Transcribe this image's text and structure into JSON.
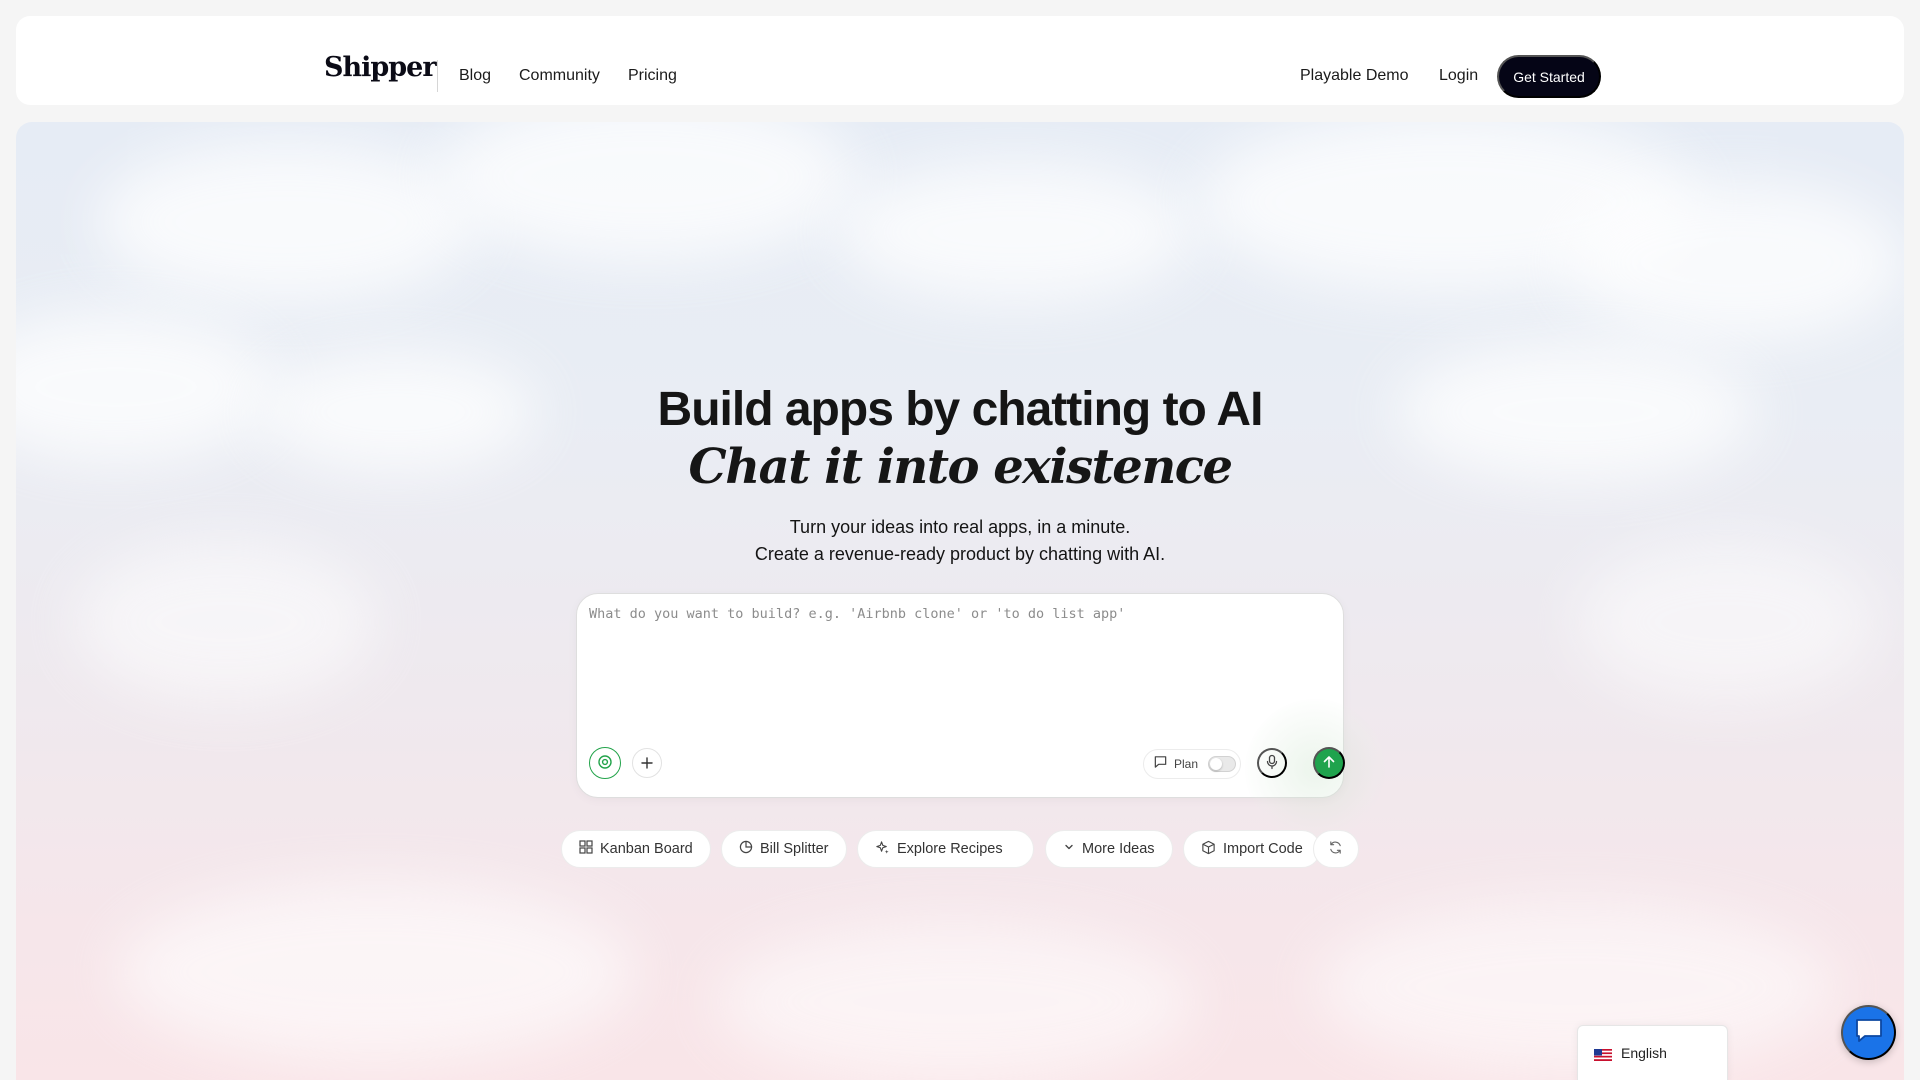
{
  "header": {
    "logo": "Shipper",
    "nav": {
      "blog": "Blog",
      "community": "Community",
      "pricing": "Pricing",
      "playable_demo": "Playable Demo",
      "login": "Login"
    },
    "cta": "Get Started"
  },
  "hero": {
    "headline": "Build apps by chatting to AI",
    "subheadline": "Chat it into existence",
    "tagline_line1": "Turn your ideas into real apps, in a minute.",
    "tagline_line2": "Create a revenue-ready product by chatting with AI."
  },
  "prompt": {
    "placeholder": "What do you want to build? e.g. 'Airbnb clone' or 'to do list app'",
    "value": "",
    "plan_label": "Plan",
    "plan_enabled": false,
    "icons": {
      "target": "target-icon",
      "add": "plus-icon",
      "plan": "chat-icon",
      "mic": "microphone-icon",
      "send": "arrow-up-icon"
    }
  },
  "suggestions": [
    {
      "label": "Kanban Board",
      "icon": "grid-icon"
    },
    {
      "label": "Bill Splitter",
      "icon": "pie-chart-icon"
    },
    {
      "label": "Explore Recipes",
      "icon": "sparkle-icon"
    },
    {
      "label": "More Ideas",
      "icon": "chevron-down-icon"
    },
    {
      "label": "Import Code",
      "icon": "package-icon"
    },
    {
      "label": "",
      "icon": "refresh-icon"
    }
  ],
  "language": {
    "current": "English",
    "flag": "us-flag-icon"
  },
  "colors": {
    "accent_green": "#1fa34d",
    "cta_dark": "#050516",
    "chat_blue": "#1a73e8"
  }
}
